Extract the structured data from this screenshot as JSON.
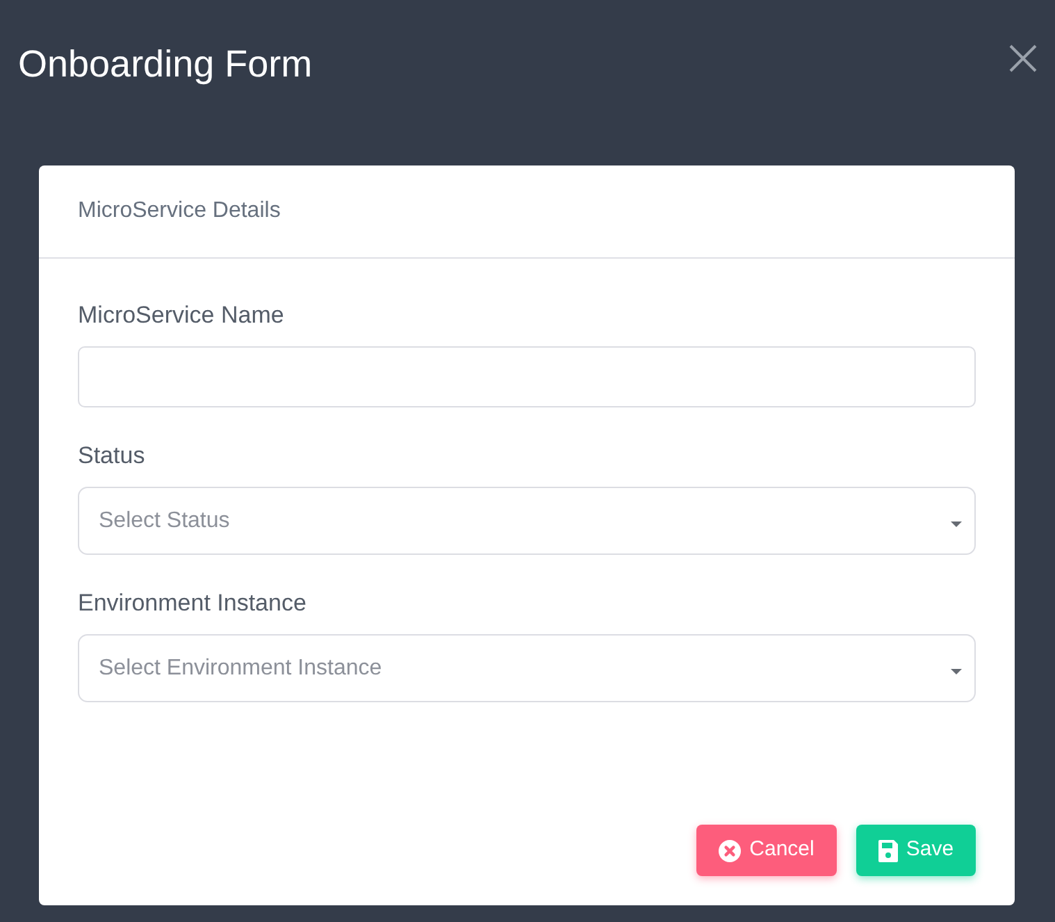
{
  "window": {
    "title": "Onboarding Form"
  },
  "card": {
    "title": "MicroService Details"
  },
  "fields": [
    {
      "kind": "text",
      "label": "MicroService Name"
    },
    {
      "kind": "select",
      "label": "Status",
      "placeholder": "Select Status"
    },
    {
      "kind": "select",
      "label": "Environment Instance",
      "placeholder": "Select Environment Instance"
    }
  ],
  "buttons": [
    {
      "kind": "cancel",
      "label": "Cancel"
    },
    {
      "kind": "save",
      "label": "Save"
    }
  ]
}
